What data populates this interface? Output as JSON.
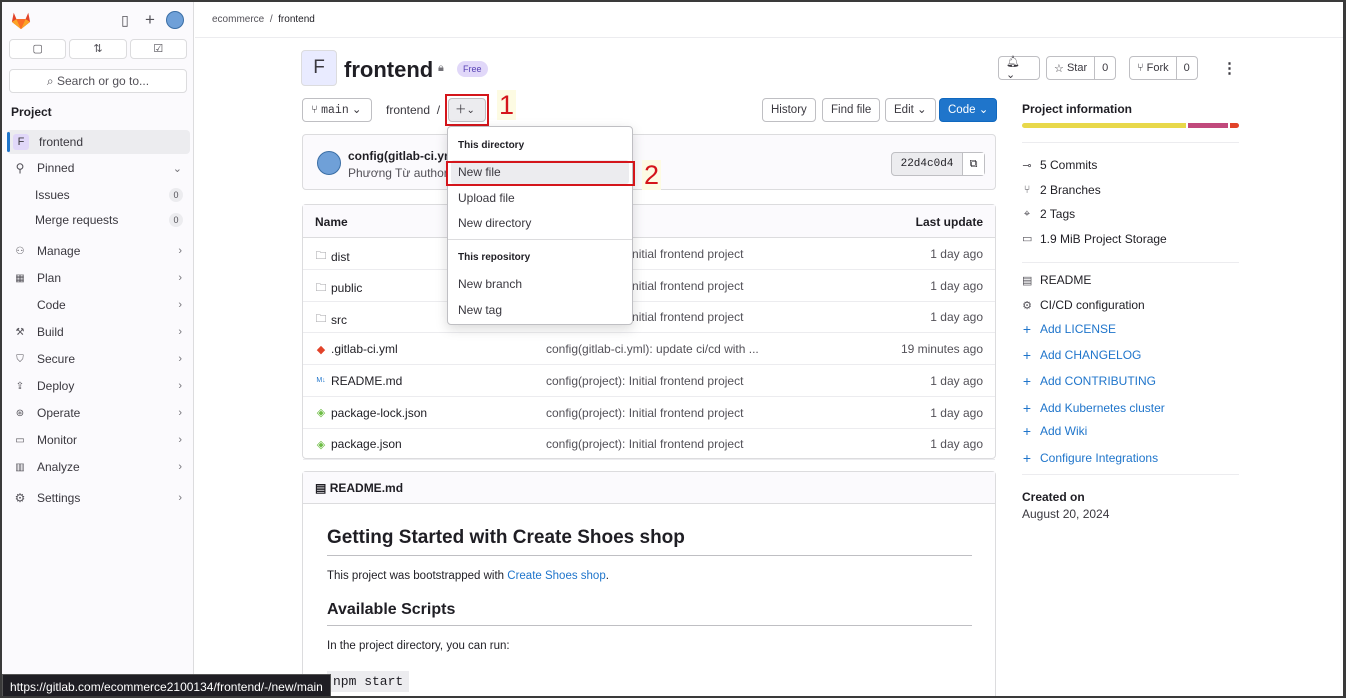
{
  "sidebar": {
    "icons": [
      "sidebar-toggle-icon",
      "plus-icon",
      "user-avatar"
    ],
    "quick": [
      "issues-icon",
      "merge-requests-icon",
      "todo-icon"
    ],
    "search_label": "Search or go to...",
    "section": "Project",
    "project_initial": "F",
    "project_name": "frontend",
    "pinned": "Pinned",
    "issues": "Issues",
    "issues_count": "0",
    "merge_requests": "Merge requests",
    "mr_count": "0",
    "items": [
      {
        "label": "Manage",
        "icon": "manage-icon"
      },
      {
        "label": "Plan",
        "icon": "plan-icon"
      },
      {
        "label": "Code",
        "icon": "code-icon"
      },
      {
        "label": "Build",
        "icon": "build-icon"
      },
      {
        "label": "Secure",
        "icon": "shield-icon"
      },
      {
        "label": "Deploy",
        "icon": "deploy-icon"
      },
      {
        "label": "Operate",
        "icon": "operate-icon"
      },
      {
        "label": "Monitor",
        "icon": "monitor-icon"
      },
      {
        "label": "Analyze",
        "icon": "analyze-icon"
      }
    ],
    "settings": "Settings"
  },
  "breadcrumb": {
    "group": "ecommerce",
    "sep": "/",
    "project": "frontend"
  },
  "header": {
    "initial": "F",
    "title": "frontend",
    "badge": "Free",
    "star_label": "Star",
    "star_count": "0",
    "fork_label": "Fork",
    "fork_count": "0"
  },
  "toolbar": {
    "branch": "main",
    "path": "frontend",
    "path_sep": "/",
    "history": "History",
    "find_file": "Find file",
    "edit": "Edit",
    "code": "Code"
  },
  "annotations": {
    "one": "1",
    "two": "2"
  },
  "commit": {
    "title": "config(gitlab-ci.yml",
    "author": "Phương Từ authored",
    "sha": "22d4c0d4"
  },
  "table": {
    "headers": {
      "name": "Name",
      "last_update": "Last update"
    },
    "rows": [
      {
        "name": "dist",
        "icon": "folder-icon",
        "commit": "config(project): Initial frontend project",
        "updated": "1 day ago"
      },
      {
        "name": "public",
        "icon": "folder-icon",
        "commit": "config(project): Initial frontend project",
        "updated": "1 day ago"
      },
      {
        "name": "src",
        "icon": "folder-icon",
        "commit": "config(project): Initial frontend project",
        "updated": "1 day ago"
      },
      {
        "name": ".gitlab-ci.yml",
        "icon": "gitlab-file-icon",
        "commit": "config(gitlab-ci.yml): update ci/cd with ...",
        "updated": "19 minutes ago"
      },
      {
        "name": "README.md",
        "icon": "markdown-icon",
        "commit": "config(project): Initial frontend project",
        "updated": "1 day ago"
      },
      {
        "name": "package-lock.json",
        "icon": "json-icon",
        "commit": "config(project): Initial frontend project",
        "updated": "1 day ago"
      },
      {
        "name": "package.json",
        "icon": "json-icon",
        "commit": "config(project): Initial frontend project",
        "updated": "1 day ago"
      }
    ]
  },
  "dropdown": {
    "group1": "This directory",
    "new_file": "New file",
    "upload_file": "Upload file",
    "new_directory": "New directory",
    "group2": "This repository",
    "new_branch": "New branch",
    "new_tag": "New tag"
  },
  "readme": {
    "file": "README.md",
    "h1": "Getting Started with Create Shoes shop",
    "p1_prefix": "This project was bootstrapped with ",
    "p1_link": "Create Shoes shop",
    "p1_suffix": ".",
    "h2": "Available Scripts",
    "p2": "In the project directory, you can run:",
    "code": "npm start"
  },
  "rail": {
    "title": "Project information",
    "language_bar": [
      {
        "color": "#e8d84a",
        "share": 0.77
      },
      {
        "color": "#c1497c",
        "share": 0.19
      },
      {
        "color": "#e24329",
        "share": 0.04
      }
    ],
    "stats": [
      {
        "label": "5 Commits",
        "icon": "commit-icon"
      },
      {
        "label": "2 Branches",
        "icon": "branch-icon"
      },
      {
        "label": "2 Tags",
        "icon": "tag-icon"
      },
      {
        "label": "1.9 MiB Project Storage",
        "icon": "storage-icon"
      }
    ],
    "readme": "README",
    "cicd": "CI/CD configuration",
    "links": [
      "Add LICENSE",
      "Add CHANGELOG",
      "Add CONTRIBUTING",
      "Add Kubernetes cluster",
      "Add Wiki",
      "Configure Integrations"
    ],
    "created_label": "Created on",
    "created_date": "August 20, 2024"
  },
  "status_url": "https://gitlab.com/ecommerce2100134/frontend/-/new/main"
}
